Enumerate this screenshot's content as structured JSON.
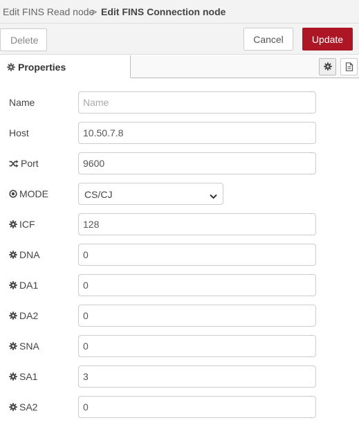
{
  "breadcrumb": {
    "previous": "Edit FINS Read node",
    "separator": ">",
    "current": "Edit FINS Connection node"
  },
  "toolbar": {
    "delete_label": "Delete",
    "cancel_label": "Cancel",
    "update_label": "Update"
  },
  "tabs": {
    "properties_label": "Properties"
  },
  "fields": {
    "name": {
      "label": "Name",
      "value": "",
      "placeholder": "Name"
    },
    "host": {
      "label": "Host",
      "value": "10.50.7.8"
    },
    "port": {
      "label": "Port",
      "value": "9600"
    },
    "mode": {
      "label": "MODE",
      "selected": "CS/CJ"
    },
    "icf": {
      "label": "ICF",
      "value": "128"
    },
    "dna": {
      "label": "DNA",
      "value": "0"
    },
    "da1": {
      "label": "DA1",
      "value": "0"
    },
    "da2": {
      "label": "DA2",
      "value": "0"
    },
    "sna": {
      "label": "SNA",
      "value": "0"
    },
    "sa1": {
      "label": "SA1",
      "value": "3"
    },
    "sa2": {
      "label": "SA2",
      "value": "0"
    }
  },
  "colors": {
    "accent": "#ad1625",
    "panel": "#f3f3f3"
  },
  "icons": {
    "tab": "gear-icon",
    "port": "shuffle-icon",
    "mode": "dot-circle-icon",
    "fields": "gear-icon",
    "side_tabs": [
      "gear-icon",
      "document-icon"
    ]
  }
}
